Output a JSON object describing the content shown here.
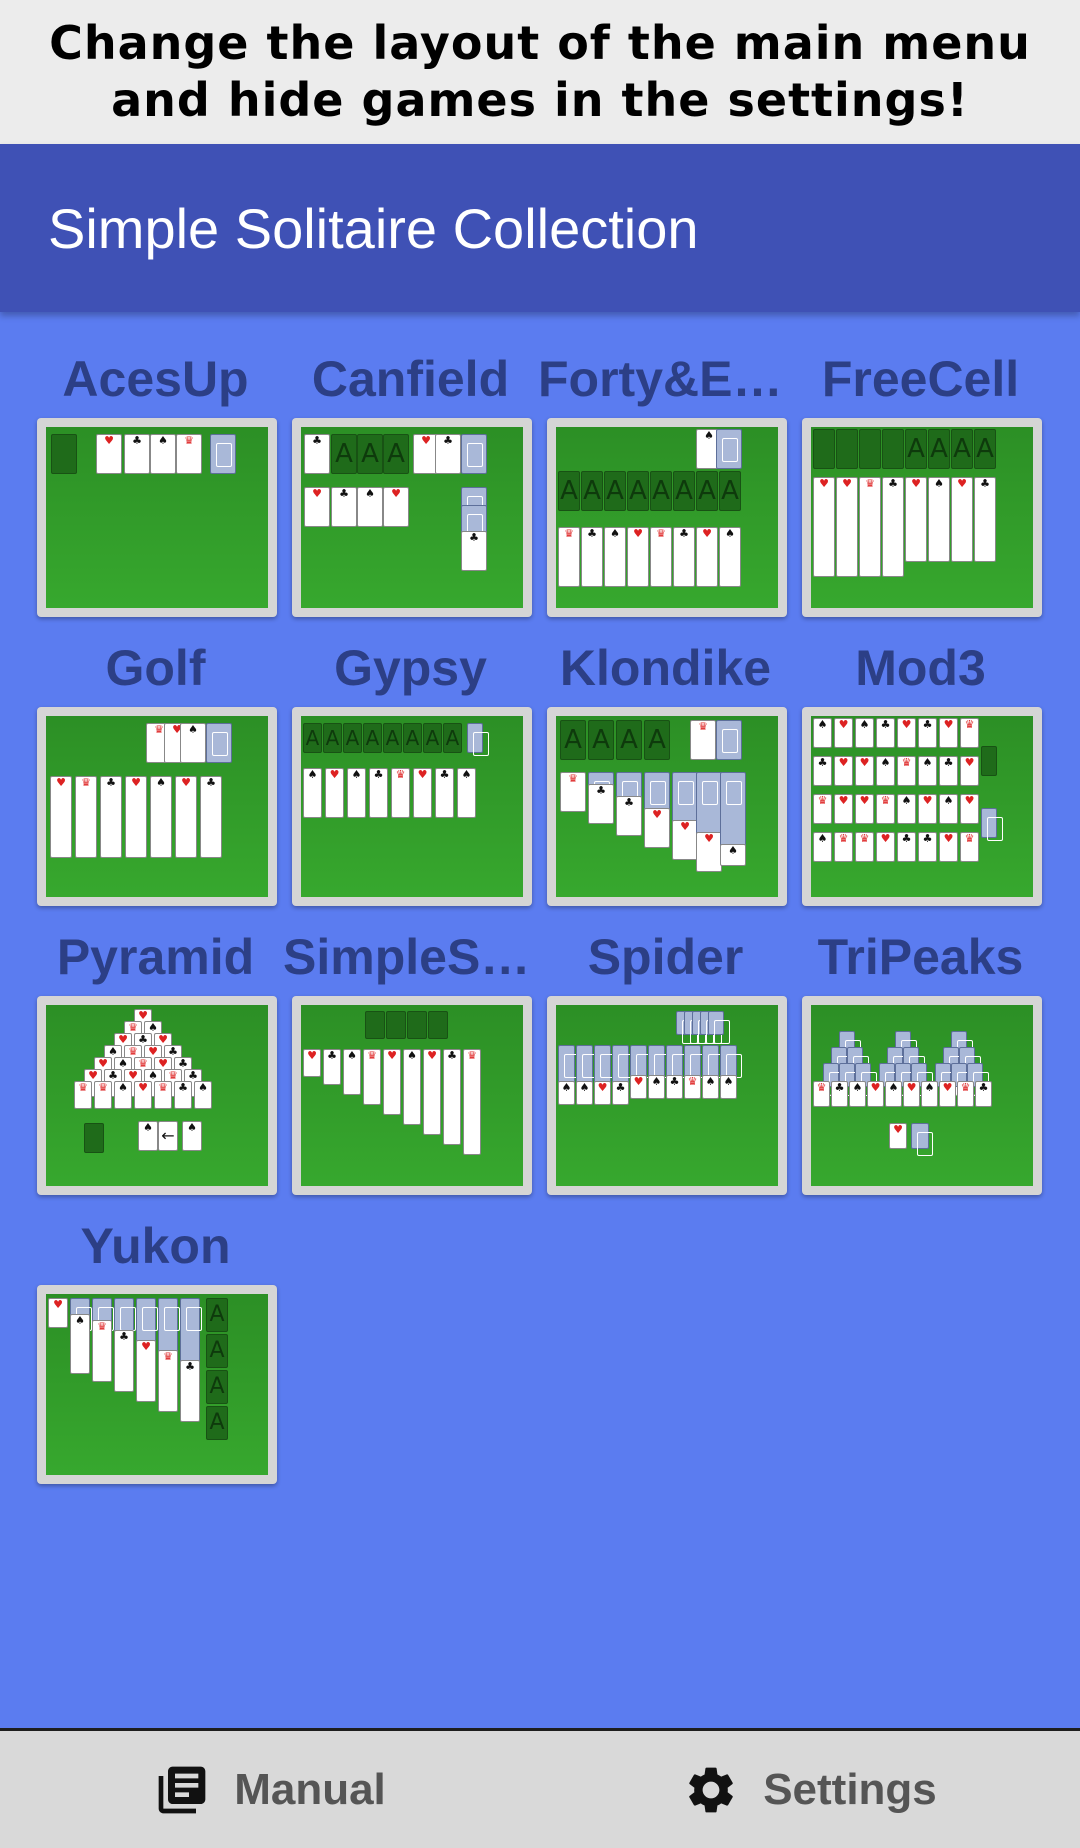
{
  "promo": {
    "line1": "Change the layout of the main menu",
    "line2": "and hide games in the settings!"
  },
  "app": {
    "title": "Simple Solitaire Collection"
  },
  "colors": {
    "appbar": "#3f51b5",
    "background": "#5b7cf0",
    "game_name": "#2c3f86",
    "felt": "#2c8f25"
  },
  "games": [
    {
      "name": "AcesUp"
    },
    {
      "name": "Canfield"
    },
    {
      "name": "Forty&Ei…"
    },
    {
      "name": "FreeCell"
    },
    {
      "name": "Golf"
    },
    {
      "name": "Gypsy"
    },
    {
      "name": "Klondike"
    },
    {
      "name": "Mod3"
    },
    {
      "name": "Pyramid"
    },
    {
      "name": "SimpleSi…"
    },
    {
      "name": "Spider"
    },
    {
      "name": "TriPeaks"
    },
    {
      "name": "Yukon"
    }
  ],
  "bottom_nav": {
    "manual_label": "Manual",
    "manual_icon": "manual-icon",
    "settings_label": "Settings",
    "settings_icon": "gear-icon"
  }
}
